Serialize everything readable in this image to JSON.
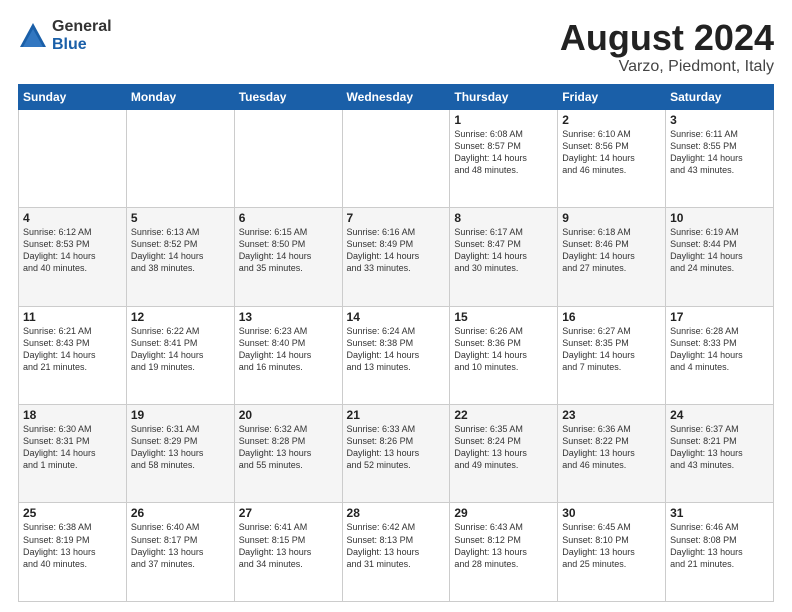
{
  "logo": {
    "general": "General",
    "blue": "Blue"
  },
  "title": "August 2024",
  "location": "Varzo, Piedmont, Italy",
  "days_of_week": [
    "Sunday",
    "Monday",
    "Tuesday",
    "Wednesday",
    "Thursday",
    "Friday",
    "Saturday"
  ],
  "weeks": [
    [
      {
        "day": "",
        "info": ""
      },
      {
        "day": "",
        "info": ""
      },
      {
        "day": "",
        "info": ""
      },
      {
        "day": "",
        "info": ""
      },
      {
        "day": "1",
        "info": "Sunrise: 6:08 AM\nSunset: 8:57 PM\nDaylight: 14 hours\nand 48 minutes."
      },
      {
        "day": "2",
        "info": "Sunrise: 6:10 AM\nSunset: 8:56 PM\nDaylight: 14 hours\nand 46 minutes."
      },
      {
        "day": "3",
        "info": "Sunrise: 6:11 AM\nSunset: 8:55 PM\nDaylight: 14 hours\nand 43 minutes."
      }
    ],
    [
      {
        "day": "4",
        "info": "Sunrise: 6:12 AM\nSunset: 8:53 PM\nDaylight: 14 hours\nand 40 minutes."
      },
      {
        "day": "5",
        "info": "Sunrise: 6:13 AM\nSunset: 8:52 PM\nDaylight: 14 hours\nand 38 minutes."
      },
      {
        "day": "6",
        "info": "Sunrise: 6:15 AM\nSunset: 8:50 PM\nDaylight: 14 hours\nand 35 minutes."
      },
      {
        "day": "7",
        "info": "Sunrise: 6:16 AM\nSunset: 8:49 PM\nDaylight: 14 hours\nand 33 minutes."
      },
      {
        "day": "8",
        "info": "Sunrise: 6:17 AM\nSunset: 8:47 PM\nDaylight: 14 hours\nand 30 minutes."
      },
      {
        "day": "9",
        "info": "Sunrise: 6:18 AM\nSunset: 8:46 PM\nDaylight: 14 hours\nand 27 minutes."
      },
      {
        "day": "10",
        "info": "Sunrise: 6:19 AM\nSunset: 8:44 PM\nDaylight: 14 hours\nand 24 minutes."
      }
    ],
    [
      {
        "day": "11",
        "info": "Sunrise: 6:21 AM\nSunset: 8:43 PM\nDaylight: 14 hours\nand 21 minutes."
      },
      {
        "day": "12",
        "info": "Sunrise: 6:22 AM\nSunset: 8:41 PM\nDaylight: 14 hours\nand 19 minutes."
      },
      {
        "day": "13",
        "info": "Sunrise: 6:23 AM\nSunset: 8:40 PM\nDaylight: 14 hours\nand 16 minutes."
      },
      {
        "day": "14",
        "info": "Sunrise: 6:24 AM\nSunset: 8:38 PM\nDaylight: 14 hours\nand 13 minutes."
      },
      {
        "day": "15",
        "info": "Sunrise: 6:26 AM\nSunset: 8:36 PM\nDaylight: 14 hours\nand 10 minutes."
      },
      {
        "day": "16",
        "info": "Sunrise: 6:27 AM\nSunset: 8:35 PM\nDaylight: 14 hours\nand 7 minutes."
      },
      {
        "day": "17",
        "info": "Sunrise: 6:28 AM\nSunset: 8:33 PM\nDaylight: 14 hours\nand 4 minutes."
      }
    ],
    [
      {
        "day": "18",
        "info": "Sunrise: 6:30 AM\nSunset: 8:31 PM\nDaylight: 14 hours\nand 1 minute."
      },
      {
        "day": "19",
        "info": "Sunrise: 6:31 AM\nSunset: 8:29 PM\nDaylight: 13 hours\nand 58 minutes."
      },
      {
        "day": "20",
        "info": "Sunrise: 6:32 AM\nSunset: 8:28 PM\nDaylight: 13 hours\nand 55 minutes."
      },
      {
        "day": "21",
        "info": "Sunrise: 6:33 AM\nSunset: 8:26 PM\nDaylight: 13 hours\nand 52 minutes."
      },
      {
        "day": "22",
        "info": "Sunrise: 6:35 AM\nSunset: 8:24 PM\nDaylight: 13 hours\nand 49 minutes."
      },
      {
        "day": "23",
        "info": "Sunrise: 6:36 AM\nSunset: 8:22 PM\nDaylight: 13 hours\nand 46 minutes."
      },
      {
        "day": "24",
        "info": "Sunrise: 6:37 AM\nSunset: 8:21 PM\nDaylight: 13 hours\nand 43 minutes."
      }
    ],
    [
      {
        "day": "25",
        "info": "Sunrise: 6:38 AM\nSunset: 8:19 PM\nDaylight: 13 hours\nand 40 minutes."
      },
      {
        "day": "26",
        "info": "Sunrise: 6:40 AM\nSunset: 8:17 PM\nDaylight: 13 hours\nand 37 minutes."
      },
      {
        "day": "27",
        "info": "Sunrise: 6:41 AM\nSunset: 8:15 PM\nDaylight: 13 hours\nand 34 minutes."
      },
      {
        "day": "28",
        "info": "Sunrise: 6:42 AM\nSunset: 8:13 PM\nDaylight: 13 hours\nand 31 minutes."
      },
      {
        "day": "29",
        "info": "Sunrise: 6:43 AM\nSunset: 8:12 PM\nDaylight: 13 hours\nand 28 minutes."
      },
      {
        "day": "30",
        "info": "Sunrise: 6:45 AM\nSunset: 8:10 PM\nDaylight: 13 hours\nand 25 minutes."
      },
      {
        "day": "31",
        "info": "Sunrise: 6:46 AM\nSunset: 8:08 PM\nDaylight: 13 hours\nand 21 minutes."
      }
    ]
  ]
}
